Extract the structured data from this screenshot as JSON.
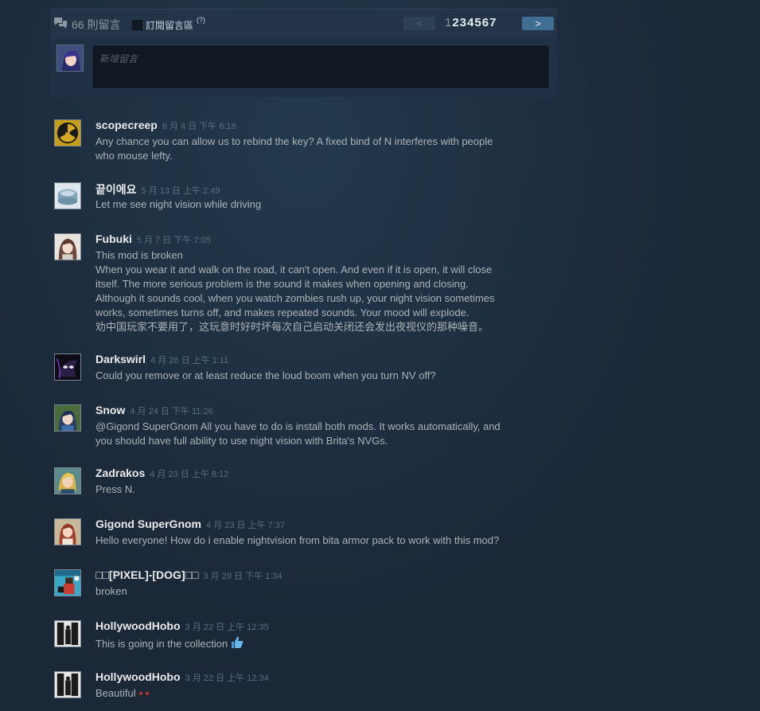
{
  "thread": {
    "count": "66",
    "count_label": "則留言",
    "subscribe_label": "訂閱留言區",
    "help": "(?)",
    "prev": "<",
    "next": ">",
    "page_current": "1",
    "page_links": "234567",
    "new_comment_placeholder": "新增留言"
  },
  "comments": [
    {
      "author": "scopecreep",
      "time": "6 月 4 日 下午 6:18",
      "text": "Any chance you can allow us to rebind the key? A fixed bind of N interferes with people\nwho mouse lefty.",
      "avatar": "radiation-icon"
    },
    {
      "author": "끝이에요",
      "time": "5 月 13 日 上午 2:49",
      "text": "Let me see night vision while driving",
      "avatar": "tin-can-icon"
    },
    {
      "author": "Fubuki",
      "time": "5 月 7 日 下午 7:05",
      "text": "This mod is broken\nWhen you wear it and walk on the road, it can't open. And even if it is open, it will close\nitself. The more serious problem is the sound it makes when opening and closing.\nAlthough it sounds cool, when you watch zombies rush up, your night vision sometimes\nworks, sometimes turns off, and makes repeated sounds. Your mood will explode.\n劝中国玩家不要用了，这玩意时好时坏每次自己启动关闭还会发出夜视仪的那种噪音。",
      "avatar": "anime-girl-icon"
    },
    {
      "author": "Darkswirl",
      "time": "4 月 26 日 上午 1:11",
      "text": "Could you remove or at least reduce the loud boom when you turn NV off?",
      "avatar": "dark-creature-icon"
    },
    {
      "author": "Snow",
      "time": "4 月 24 日 下午 11:26",
      "text": "@Gigond SuperGnom All you have to do is install both mods. It works automatically, and\nyou should have full ability to use night vision with Brita's NVGs.",
      "avatar": "anime-boy-icon"
    },
    {
      "author": "Zadrakos",
      "time": "4 月 23 日 上午 8:12",
      "text": "Press N.",
      "avatar": "blonde-character-icon"
    },
    {
      "author": "Gigond SuperGnom",
      "time": "4 月 23 日 上午 7:37",
      "text": "Hello everyone! How do i enable nightvision from bita armor pack to work with this mod?",
      "avatar": "redhead-character-icon"
    },
    {
      "author": "□□[PIXEL]-[DOG]□□",
      "time": "3 月 29 日 下午 1:34",
      "text": "broken",
      "avatar": "pixel-art-icon"
    },
    {
      "author": "HollywoodHobo",
      "time": "3 月 22 日 上午 12:35",
      "text": "This is going in the collection",
      "avatar": "doorway-figure-icon",
      "emoji": "thumbs-up-icon"
    },
    {
      "author": "HollywoodHobo",
      "time": "3 月 22 日 上午 12:34",
      "text": "Beautiful",
      "avatar": "doorway-figure-icon",
      "emoji": "red-dots-icon"
    }
  ]
}
